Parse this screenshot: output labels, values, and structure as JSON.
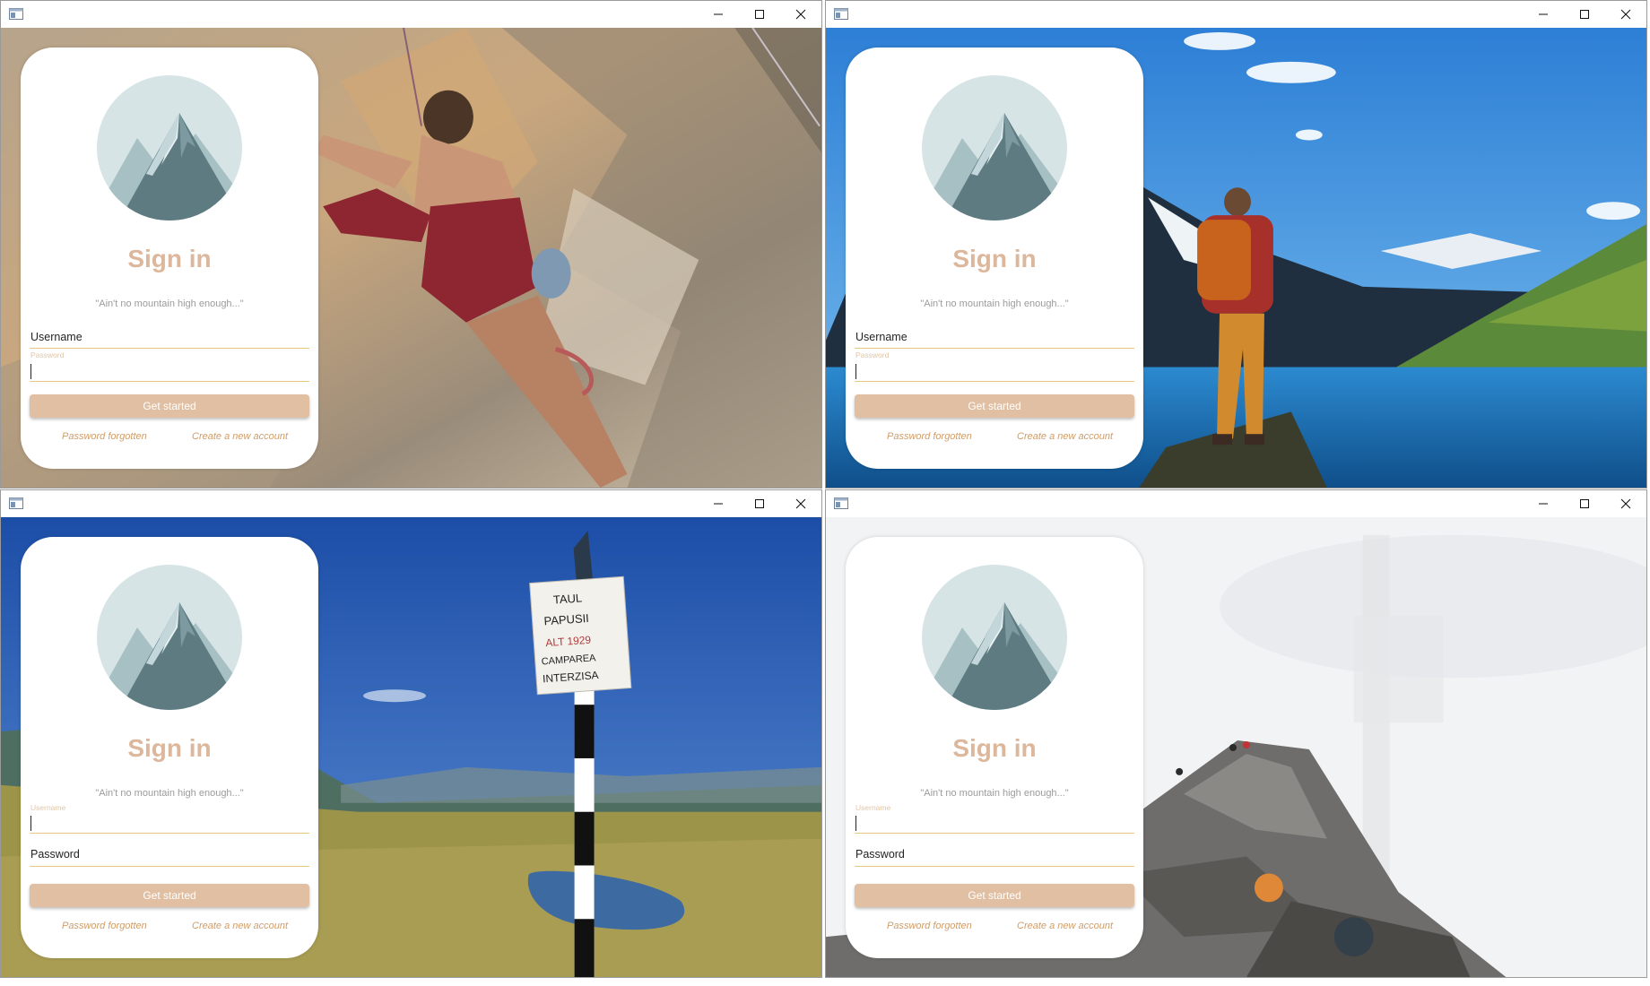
{
  "windows": [
    {
      "id": "climber",
      "username_label": "Username",
      "password_label": "Password",
      "focused_field": "password"
    },
    {
      "id": "hiker-lake",
      "username_label": "Username",
      "password_label": "Password",
      "focused_field": "password"
    },
    {
      "id": "sign-post",
      "username_label": "Username",
      "password_label": "Password",
      "focused_field": "username",
      "sign_text": [
        "TAUL",
        "PAPUSII",
        "ALT 1929",
        "CAMPAREA",
        "INTERZISA"
      ]
    },
    {
      "id": "rocky-summit",
      "username_label": "Username",
      "password_label": "Password",
      "focused_field": "username"
    }
  ],
  "card": {
    "title": "Sign in",
    "tagline": "\"Ain't no mountain high enough...\"",
    "button_label": "Get started",
    "forgot_link": "Password forgotten",
    "create_link": "Create a new account"
  },
  "colors": {
    "accent": "#dcb79c",
    "button": "#e0bfa2",
    "link": "#cf9d6a",
    "underline": "#e6c680"
  },
  "icons": {
    "app": "app-window-icon",
    "minimize": "minimize-icon",
    "maximize": "maximize-icon",
    "close": "close-icon",
    "logo": "mountain-logo-icon"
  }
}
